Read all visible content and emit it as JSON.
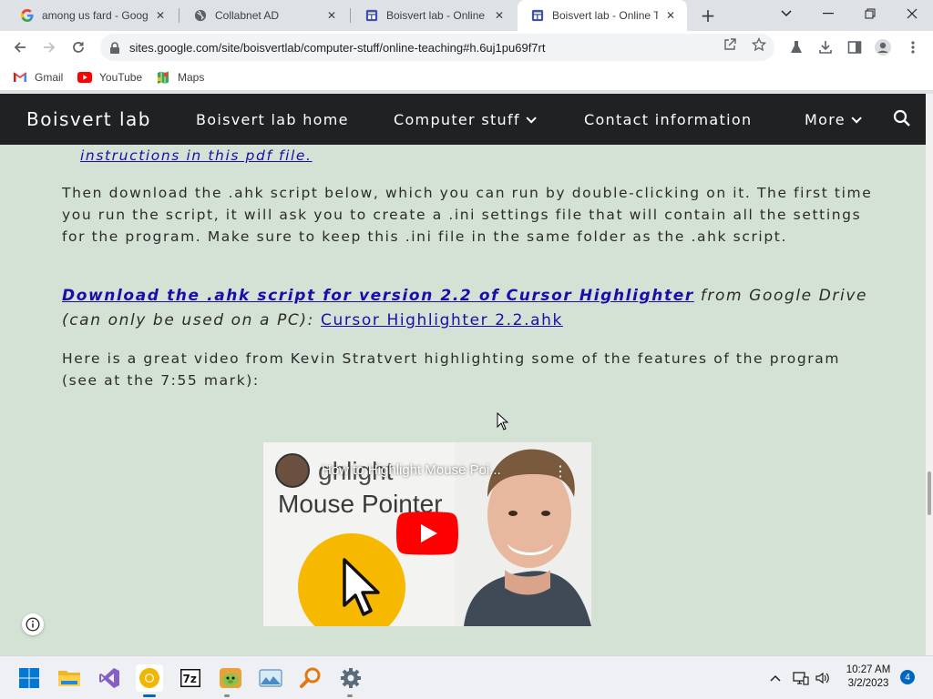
{
  "browser": {
    "tabs": [
      {
        "title": "among us fard - Googl",
        "favicon": "google-g-icon",
        "active": false
      },
      {
        "title": "Collabnet AD",
        "favicon": "globe-icon",
        "active": false
      },
      {
        "title": "Boisvert lab - Online Te",
        "favicon": "google-sites-icon",
        "active": false
      },
      {
        "title": "Boisvert lab - Online Te",
        "favicon": "google-sites-icon",
        "active": true
      }
    ],
    "url": "sites.google.com/site/boisvertlab/computer-stuff/online-teaching#h.6uj1pu69f7rt",
    "bookmarks": [
      {
        "label": "Gmail",
        "icon": "gmail-icon"
      },
      {
        "label": "YouTube",
        "icon": "youtube-icon"
      },
      {
        "label": "Maps",
        "icon": "maps-icon"
      }
    ]
  },
  "site": {
    "brand": "Boisvert lab",
    "nav": [
      {
        "label": "Boisvert lab home",
        "dropdown": false
      },
      {
        "label": "Computer stuff",
        "dropdown": true
      },
      {
        "label": "Contact information",
        "dropdown": false
      },
      {
        "label": "More",
        "dropdown": true
      }
    ]
  },
  "content": {
    "pdf_link": "instructions in this pdf file.",
    "para1": "Then download the .ahk script below, which you can run by double-clicking on it. The first time you run the script, it will ask you to create a .ini settings file that will contain all the settings for the program. Make sure to keep this .ini file in the same folder as the .ahk script.",
    "download_link": "Download the .ahk script for version 2.2 of Cursor Highlighter",
    "download_from": " from Google Drive (can only be used on a PC): ",
    "file_link": "Cursor Highlighter 2.2.ahk",
    "para3": "Here is a great video from Kevin Stratvert highlighting some of the features of the program (see at the 7:55 mark):",
    "video": {
      "title": "How to Highlight Mouse Poi...",
      "ghost_title": "ghlight",
      "thumb_title": "Mouse Pointer"
    }
  },
  "taskbar": {
    "apps": [
      "start-icon",
      "file-explorer-icon",
      "visual-studio-icon",
      "chrome-icon",
      "7zip-icon",
      "game-icon",
      "photos-icon",
      "search-tool-icon",
      "settings-icon"
    ],
    "time": "10:27 AM",
    "date": "3/2/2023",
    "notifications": "4"
  },
  "colors": {
    "header_bg": "#1f2123",
    "content_bg": "#d3e2d4",
    "link": "#1a0dab"
  }
}
